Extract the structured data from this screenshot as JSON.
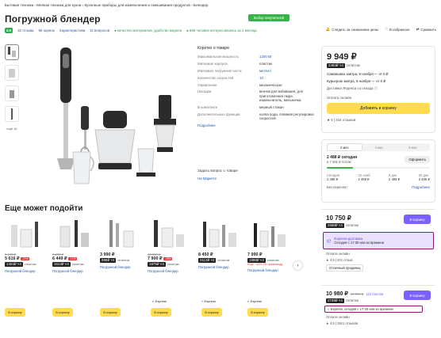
{
  "breadcrumbs": "Бытовая техника  ›  Мелкая техника для кухни  ›  Кухонные приборы для измельчения и смешивания продуктов  ›  Блендер",
  "title": "Погружной блендер",
  "choice_badge": "Выбор покупателей",
  "meta": {
    "rating": "4.9",
    "reviews": "32 отзыва",
    "ratings": "96 оценок",
    "characteristics": "Характеристики",
    "questions": "11 вопросов",
    "quality": "● качество материалов, удобство модели",
    "interest": "● 696 человек интересовались за 2 месяца"
  },
  "actions": {
    "follow_price": "Следить за снижением цены",
    "favorite": "В избранное",
    "compare": "Сравнить"
  },
  "thumbs_more": "ещё 16",
  "specs": {
    "heading": "Коротко о товаре",
    "rows": [
      {
        "k": "Максимальная мощность",
        "v": "1200 Вт",
        "link": true
      },
      {
        "k": "Материал корпуса",
        "v": "пластик",
        "link": false
      },
      {
        "k": "Материал погружной части",
        "v": "металл",
        "link": true
      },
      {
        "k": "Количество скоростей",
        "v": "10",
        "link": true
      },
      {
        "k": "Управление",
        "v": "механическое",
        "link": false
      },
      {
        "k": "Насадки",
        "v": "венчик для взбивания, для приготовления пюре, измельчитель, мельничка",
        "link": false
      },
      {
        "k": "В комплекте",
        "v": "мерный стакан",
        "link": false
      },
      {
        "k": "Дополнительные функции",
        "v": "колпа пода, плавная регулировка скоростей",
        "link": false
      }
    ],
    "more": "Подробнее",
    "ask": "Задать вопрос о товаре",
    "market": "На Маркете"
  },
  "buybox": {
    "price": "9 949 ₽",
    "split_price": "2483₽ ×4",
    "split_label": "сплитом",
    "pickup1": "Самовывоз завтра, 9 ноября — от 0 ₽",
    "courier": "Курьером завтра, 9 ноября — от 0 ₽",
    "delivery_note": "Доставка Яндекса со склада ⓘ",
    "payment": "Оплата онлайн",
    "cart_button": "Добавить в корзину",
    "seller_stats": "★ 5 | 315 отзывов"
  },
  "split_panel": {
    "tabs": [
      "2 мес",
      "4 мес",
      "6 мес"
    ],
    "amount": "2 488 ₽ сегодня",
    "rest": "и 7 461 ₽ потом",
    "button": "Оформить",
    "schedule": [
      {
        "d": "Сегодня",
        "v": "2 488 ₽"
      },
      {
        "d": "22 нояб",
        "v": "2 488 ₽"
      },
      {
        "d": "6 дек",
        "v": "2 488 ₽"
      },
      {
        "d": "20 дек",
        "v": "2 485 ₽"
      }
    ],
    "no_overpay": "Без переплат",
    "details": "Подробнее"
  },
  "offer1": {
    "price": "10 750 ₽",
    "split": "2688₽ ×4",
    "split_label": "сплитом",
    "button": "В корзину",
    "express_title": "Express-доставка",
    "express_sub": "Сегодня с 17:30 или ко времени",
    "payment": "Оплата онлайн",
    "seller_stats": "★ 4,9 | 201 отзыв",
    "seller_badge": "Отличный продавец"
  },
  "offer2": {
    "price": "10 980 ₽",
    "old_price": "34 990 ₽",
    "bonus": "110 баллов",
    "split": "2745₽ ×4",
    "split_label": "сплитом",
    "button": "В корзину",
    "express_line": "Express, сегодня с 17:30 или ко времени",
    "payment": "Оплата онлайн",
    "seller_stats": "★ 4,9 | 3911 отзывов"
  },
  "also_title": "Еще может подойти",
  "cards": [
    {
      "old": "7 168 ₽",
      "price": "5 616 ₽",
      "disc": "-22%",
      "split": "1404₽ ×4",
      "split_label": "сплитом",
      "name": "Погружной блендер",
      "extra": "",
      "express": ""
    },
    {
      "old": "7 208 ₽",
      "price": "6 449 ₽",
      "disc": "-11%",
      "split": "1613₽ ×4",
      "split_label": "сплитом",
      "name": "Погружной блендер",
      "extra": "",
      "express": ""
    },
    {
      "old": "",
      "price": "3 990 ₽",
      "disc": "",
      "split": "998₽ ×4",
      "split_label": "сплитом",
      "name": "Погружной блендер",
      "extra": "",
      "express": "Express"
    },
    {
      "old": "10 990 ₽",
      "price": "7 900 ₽",
      "disc": "-28%",
      "split": "1975₽ ×4",
      "split_label": "сплитом",
      "name": "Погружной блендер",
      "extra": "",
      "express": ""
    },
    {
      "old": "",
      "price": "8 450 ₽",
      "disc": "",
      "split": "2113₽ ×4",
      "split_label": "сплитом",
      "name": "Погружной блендер",
      "extra": "",
      "express": "Express"
    },
    {
      "old": "",
      "price": "7 990 ₽",
      "disc": "",
      "split": "1998₽ ×4",
      "split_label": "сплитом",
      "name": "Погружной блендер",
      "extra": "Ещё −10% По промокоду",
      "express": "Express"
    }
  ],
  "card_button": "В корзину"
}
